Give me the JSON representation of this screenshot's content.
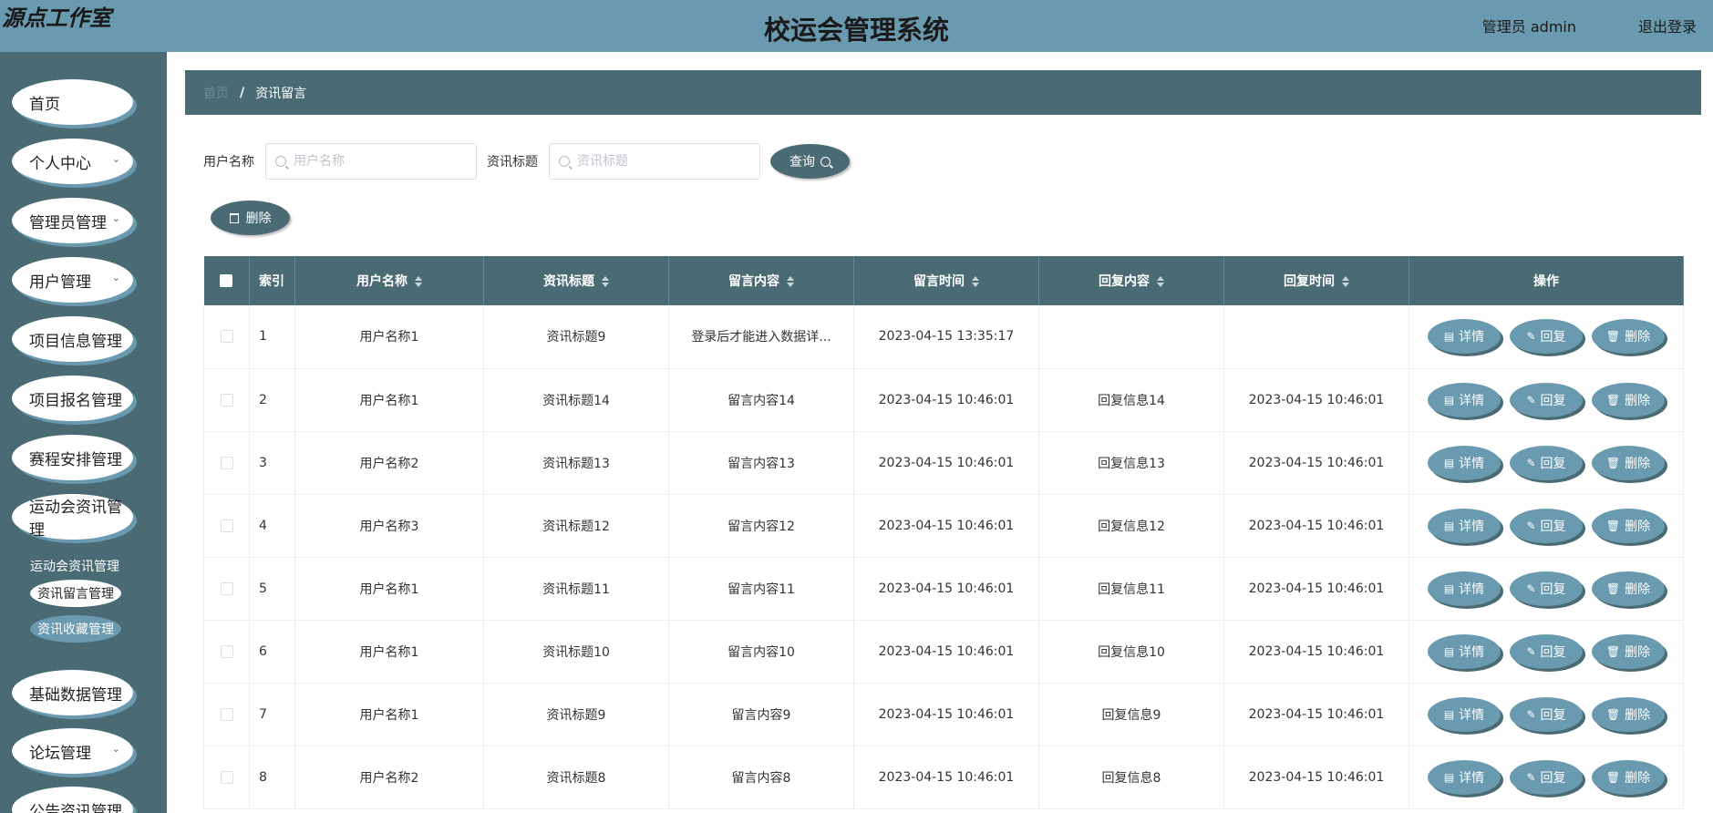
{
  "header": {
    "logo": "源点工作室",
    "title": "校运会管理系统",
    "user": "管理员 admin",
    "logout": "退出登录"
  },
  "sidebar": {
    "items": [
      {
        "label": "首页",
        "arrow": ""
      },
      {
        "label": "个人中心",
        "arrow": "⌄"
      },
      {
        "label": "管理员管理",
        "arrow": "⌄"
      },
      {
        "label": "用户管理",
        "arrow": "⌄"
      },
      {
        "label": "项目信息管理",
        "arrow": ""
      },
      {
        "label": "项目报名管理",
        "arrow": ""
      },
      {
        "label": "赛程安排管理",
        "arrow": ""
      },
      {
        "label": "运动会资讯管理",
        "arrow": ""
      }
    ],
    "sub_items": [
      "运动会资讯管理",
      "资讯留言管理",
      "资讯收藏管理"
    ],
    "items_after": [
      {
        "label": "基础数据管理",
        "arrow": ""
      },
      {
        "label": "论坛管理",
        "arrow": "⌄"
      },
      {
        "label": "公告资讯管理",
        "arrow": ""
      }
    ]
  },
  "breadcrumb": {
    "home": "首页",
    "separator": "/",
    "current": "资讯留言"
  },
  "search": {
    "username_label": "用户名称",
    "username_placeholder": "用户名称",
    "title_label": "资讯标题",
    "title_placeholder": "资讯标题",
    "query_label": "查询"
  },
  "toolbar": {
    "delete_label": "删除"
  },
  "table": {
    "headers": [
      "索引",
      "用户名称",
      "资讯标题",
      "留言内容",
      "留言时间",
      "回复内容",
      "回复时间",
      "操作"
    ],
    "actions": {
      "detail": "详情",
      "reply": "回复",
      "delete": "删除"
    },
    "rows": [
      [
        "1",
        "用户名称1",
        "资讯标题9",
        "登录后才能进入数据详...",
        "2023-04-15 13:35:17",
        "",
        ""
      ],
      [
        "2",
        "用户名称1",
        "资讯标题14",
        "留言内容14",
        "2023-04-15 10:46:01",
        "回复信息14",
        "2023-04-15 10:46:01"
      ],
      [
        "3",
        "用户名称2",
        "资讯标题13",
        "留言内容13",
        "2023-04-15 10:46:01",
        "回复信息13",
        "2023-04-15 10:46:01"
      ],
      [
        "4",
        "用户名称3",
        "资讯标题12",
        "留言内容12",
        "2023-04-15 10:46:01",
        "回复信息12",
        "2023-04-15 10:46:01"
      ],
      [
        "5",
        "用户名称1",
        "资讯标题11",
        "留言内容11",
        "2023-04-15 10:46:01",
        "回复信息11",
        "2023-04-15 10:46:01"
      ],
      [
        "6",
        "用户名称1",
        "资讯标题10",
        "留言内容10",
        "2023-04-15 10:46:01",
        "回复信息10",
        "2023-04-15 10:46:01"
      ],
      [
        "7",
        "用户名称1",
        "资讯标题9",
        "留言内容9",
        "2023-04-15 10:46:01",
        "回复信息9",
        "2023-04-15 10:46:01"
      ],
      [
        "8",
        "用户名称2",
        "资讯标题8",
        "留言内容8",
        "2023-04-15 10:46:01",
        "回复信息8",
        "2023-04-15 10:46:01"
      ]
    ]
  },
  "colors": {
    "header_bg": "#6a9aaf",
    "sidebar_bg": "#4b6b74",
    "accent": "#6a9aaf",
    "dark": "#4b6b74"
  }
}
